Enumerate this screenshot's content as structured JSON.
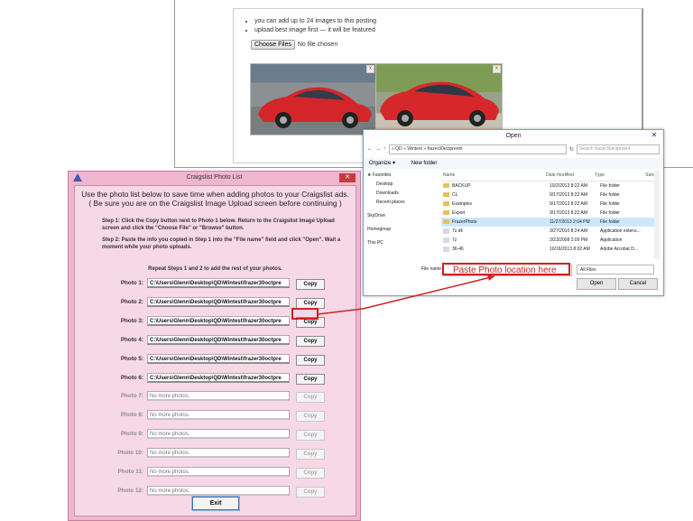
{
  "webpage": {
    "bullets": [
      "you can add up to 24 images to this posting",
      "upload best image first — it will be featured"
    ],
    "choose_files_label": "Choose Files",
    "no_file_text": "No file chosen",
    "remove_photo_glyph": "x"
  },
  "open_dialog": {
    "title": "Open",
    "close_glyph": "✕",
    "address": "»  QD  »  Wintest  »  frazer30ectpreent",
    "search_placeholder": "Search frazer30ectpreent",
    "organize_label": "Organize ▾",
    "new_folder_label": "New folder",
    "nav_items": [
      "★ Favorites",
      "Desktop",
      "Downloads",
      "Recent places",
      "SkyDrive",
      "Homegroup",
      "This PC"
    ],
    "columns": [
      "Name",
      "Date modified",
      "Type",
      "Size"
    ],
    "files": [
      {
        "name": "BACKUP",
        "date": "10/2/2013 8:22 AM",
        "type": "File folder",
        "folder": true
      },
      {
        "name": "CL",
        "date": "9/17/2013 8:22 AM",
        "type": "File folder",
        "folder": true
      },
      {
        "name": "Examples",
        "date": "9/17/2013 8:22 AM",
        "type": "File folder",
        "folder": true
      },
      {
        "name": "Export",
        "date": "9/17/2013 8:22 AM",
        "type": "File folder",
        "folder": true
      },
      {
        "name": "FrazerPhoto",
        "date": "11/27/2013 2:04 PM",
        "type": "File folder",
        "folder": true,
        "selected": true
      },
      {
        "name": "7z.dll",
        "date": "3/27/2010 8:24 AM",
        "type": "Application extens...",
        "folder": false
      },
      {
        "name": "7z",
        "date": "3/23/2008 2:09 PM",
        "type": "Application",
        "folder": false
      },
      {
        "name": "36-46",
        "date": "10/16/2013 8:02 AM",
        "type": "Adobe Acrobat D...",
        "folder": false
      }
    ],
    "file_name_label": "File name:",
    "filter_value": "All Files",
    "open_label": "Open",
    "cancel_label": "Cancel"
  },
  "callout": {
    "text": "Paste Photo location here",
    "color": "#cc2222"
  },
  "photo_list": {
    "title": "Craigslist Photo List",
    "close_glyph": "✕",
    "intro_line1": "Use the photo list below to save time when adding photos to your Craigslist ads.",
    "intro_line2": "( Be sure you are on the Craigslist Image Upload screen before continuing )",
    "step1": "Step 1: Click the Copy button next to Photo 1 below. Return to the Craigslist Image Upload screen and click the \"Choose File\" or \"Browse\" button.",
    "step2": "Step 2: Paste the info you copied in Step 1 into the \"File name\" field and click \"Open\". Wait a moment while your photo uploads.",
    "repeat": "Repeat Steps 1 and 2 to add the rest of your photos.",
    "copy_label": "Copy",
    "exit_label": "Exit",
    "photos": [
      {
        "label": "Photo 1:",
        "path": "C:\\Users\\Glenn\\Desktop\\QD\\Wintest\\frazer30octpre",
        "enabled": true
      },
      {
        "label": "Photo 2:",
        "path": "C:\\Users\\Glenn\\Desktop\\QD\\Wintest\\frazer30octpre",
        "enabled": true
      },
      {
        "label": "Photo 3:",
        "path": "C:\\Users\\Glenn\\Desktop\\QD\\Wintest\\frazer30octpre",
        "enabled": true
      },
      {
        "label": "Photo 4:",
        "path": "C:\\Users\\Glenn\\Desktop\\QD\\Wintest\\frazer30octpre",
        "enabled": true
      },
      {
        "label": "Photo 5:",
        "path": "C:\\Users\\Glenn\\Desktop\\QD\\Wintest\\frazer30octpre",
        "enabled": true
      },
      {
        "label": "Photo 6:",
        "path": "C:\\Users\\Glenn\\Desktop\\QD\\Wintest\\frazer30octpre",
        "enabled": true
      },
      {
        "label": "Photo 7:",
        "path": "No more photos.",
        "enabled": false
      },
      {
        "label": "Photo 8:",
        "path": "No more photos.",
        "enabled": false
      },
      {
        "label": "Photo 9:",
        "path": "No more photos.",
        "enabled": false
      },
      {
        "label": "Photo 10:",
        "path": "No more photos.",
        "enabled": false
      },
      {
        "label": "Photo 11:",
        "path": "No more photos.",
        "enabled": false
      },
      {
        "label": "Photo 12:",
        "path": "No more photos.",
        "enabled": false
      }
    ]
  }
}
